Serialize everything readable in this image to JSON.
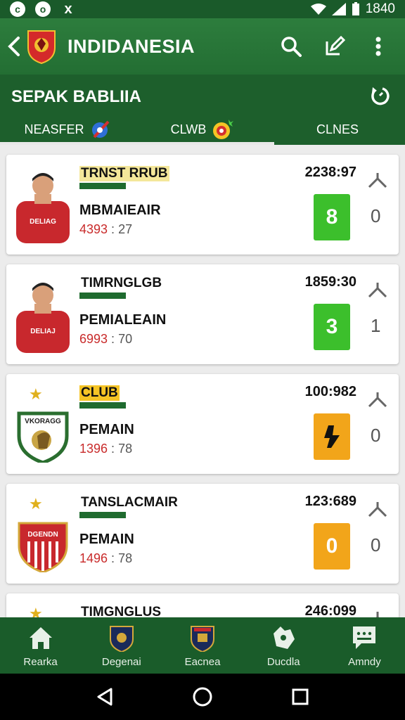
{
  "statusbar": {
    "icons": [
      "c-icon",
      "o-icon",
      "x-icon"
    ],
    "left_glyphs": [
      "c",
      "o",
      "x"
    ],
    "time": "1840"
  },
  "appbar": {
    "title": "INDIDANESIA"
  },
  "section": {
    "title": "SEPAK BABLIIA"
  },
  "tabs": [
    {
      "label": "NEASFER"
    },
    {
      "label": "CLWB"
    },
    {
      "label": "CLNES"
    }
  ],
  "cards": [
    {
      "title": "TRNST RRUB",
      "time": "2238:97",
      "name": "MBMAIEAIR",
      "stat_a": "4393",
      "stat_b": "27",
      "score": "8",
      "alt": "0",
      "score_color": "#3cbf2c",
      "avatar": "player-red"
    },
    {
      "title": "TIMRNGLGB",
      "time": "1859:30",
      "name": "PEMIALEAIN",
      "stat_a": "6993",
      "stat_b": "70",
      "score": "3",
      "alt": "1",
      "score_color": "#3cbf2c",
      "avatar": "player-red"
    },
    {
      "title": "CLUB",
      "time": "100:982",
      "name": "PEMAIN",
      "stat_a": "1396",
      "stat_b": "78",
      "score": "",
      "alt": "0",
      "score_color": "#f2a51a",
      "avatar": "badge-green",
      "badge_text": "VKORAGG"
    },
    {
      "title": "TANSLACMAIR",
      "time": "123:689",
      "name": "PEMAIN",
      "stat_a": "1496",
      "stat_b": "78",
      "score": "0",
      "alt": "0",
      "score_color": "#f2a51a",
      "avatar": "badge-red",
      "badge_text": "DGENDN"
    },
    {
      "title": "TIMGNGLUS",
      "time": "246:099"
    }
  ],
  "bottomnav": [
    {
      "label": "Rearka",
      "icon": "home-icon"
    },
    {
      "label": "Degenai",
      "icon": "club-crest-icon"
    },
    {
      "label": "Eacnea",
      "icon": "club-crest-icon"
    },
    {
      "label": "Ducdla",
      "icon": "map-icon"
    },
    {
      "label": "Amndy",
      "icon": "chat-icon"
    }
  ],
  "colors": {
    "primary": "#236e33",
    "dark": "#1d5f2c",
    "green_score": "#3cbf2c",
    "orange_score": "#f2a51a",
    "red_text": "#c92b2b"
  }
}
